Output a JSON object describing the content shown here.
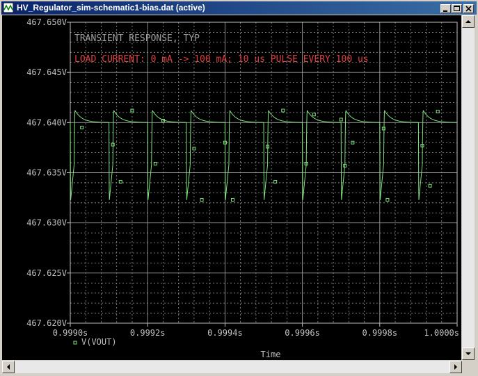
{
  "window": {
    "title": "HV_Regulator_sim-schematic1-bias.dat (active)"
  },
  "colors": {
    "plot_bg": "#000000",
    "axis": "#c0c0c0",
    "grid": "#9a9a9a",
    "trace": "#7fe07f",
    "note1": "#a0a0a0",
    "note2": "#e04040"
  },
  "chart_data": {
    "type": "line",
    "xlabel": "Time",
    "ylabel": "",
    "x_ticks": [
      {
        "value": 0.999,
        "label": "0.9990s"
      },
      {
        "value": 0.9992,
        "label": "0.9992s"
      },
      {
        "value": 0.9994,
        "label": "0.9994s"
      },
      {
        "value": 0.9996,
        "label": "0.9996s"
      },
      {
        "value": 0.9998,
        "label": "0.9998s"
      },
      {
        "value": 1.0,
        "label": "1.0000s"
      }
    ],
    "y_ticks": [
      {
        "value": 467.62,
        "label": "467.620V"
      },
      {
        "value": 467.625,
        "label": "467.625V"
      },
      {
        "value": 467.63,
        "label": "467.630V"
      },
      {
        "value": 467.635,
        "label": "467.635V"
      },
      {
        "value": 467.64,
        "label": "467.640V"
      },
      {
        "value": 467.645,
        "label": "467.645V"
      },
      {
        "value": 467.65,
        "label": "467.650V"
      }
    ],
    "xlim": [
      0.999,
      1.0
    ],
    "ylim": [
      467.62,
      467.65
    ],
    "grid": true,
    "legend": "bottom-left",
    "annotations": [
      "TRANSIENT RESPONSE, TYP",
      "LOAD CURRENT: 0 mA -> 100 mA; 10 us PULSE EVERY 100 us"
    ],
    "series": [
      {
        "name": "V(VOUT)",
        "pulse_period": 0.0001,
        "pulse_width": 1e-05,
        "first_pulse_start": 0.999,
        "pulse_starts": [
          0.999,
          0.9991,
          0.9992,
          0.9993,
          0.9994,
          0.9995,
          0.9996,
          0.9997,
          0.9998,
          0.9999
        ],
        "v_rest": 467.64,
        "v_min": 467.6322,
        "v_droop_end": 467.6358,
        "v_overshoot": 467.6412,
        "marker_points": [
          [
            0.99903,
            467.6395
          ],
          [
            0.99911,
            467.6378
          ],
          [
            0.99913,
            467.6341
          ],
          [
            0.99916,
            467.6412
          ],
          [
            0.99922,
            467.6359
          ],
          [
            0.99924,
            467.6402
          ],
          [
            0.99932,
            467.6374
          ],
          [
            0.99934,
            467.6323
          ],
          [
            0.9994,
            467.638
          ],
          [
            0.99942,
            467.6323
          ],
          [
            0.99951,
            467.6376
          ],
          [
            0.99953,
            467.6341
          ],
          [
            0.99955,
            467.6412
          ],
          [
            0.99961,
            467.6359
          ],
          [
            0.99963,
            467.6408
          ],
          [
            0.9997,
            467.6403
          ],
          [
            0.99971,
            467.6357
          ],
          [
            0.99973,
            467.638
          ],
          [
            0.99981,
            467.6394
          ],
          [
            0.99982,
            467.6323
          ],
          [
            0.99991,
            467.6377
          ],
          [
            0.99993,
            467.6337
          ],
          [
            0.99995,
            467.6411
          ]
        ]
      }
    ]
  }
}
